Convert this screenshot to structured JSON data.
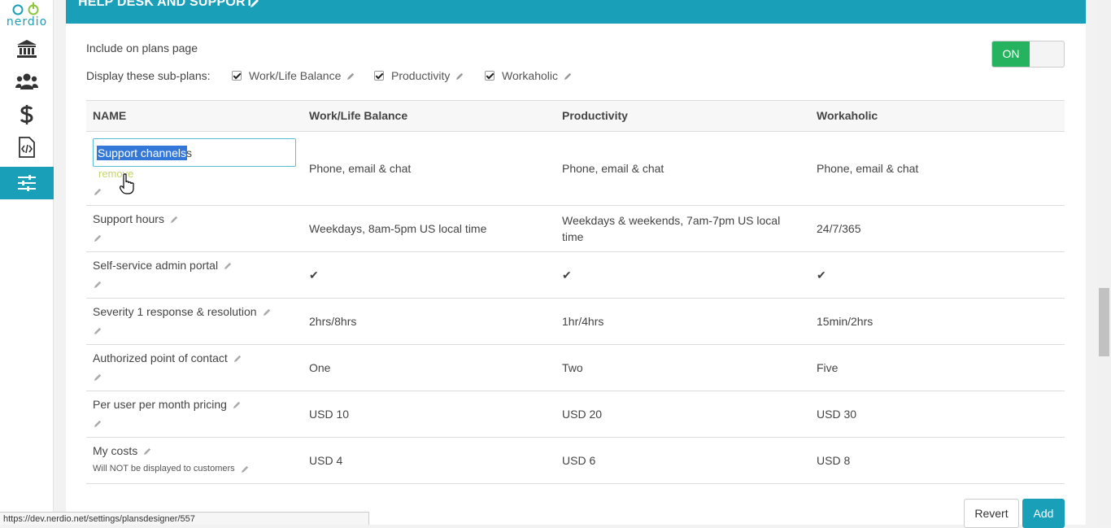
{
  "sidebar": {
    "logo_text": "nerdio",
    "items": [
      {
        "icon": "bank-icon",
        "active": false
      },
      {
        "icon": "users-icon",
        "active": false
      },
      {
        "icon": "dollar-icon",
        "active": false
      },
      {
        "icon": "code-file-icon",
        "active": false
      },
      {
        "icon": "sliders-icon",
        "active": true
      }
    ]
  },
  "card": {
    "title": "HELP DESK AND SUPPORT",
    "include_label": "Include on plans page",
    "toggle_label": "ON",
    "display_label": "Display these sub-plans:",
    "subplans": [
      "Work/Life Balance",
      "Productivity",
      "Workaholic"
    ]
  },
  "table": {
    "headers": [
      "NAME",
      "Work/Life Balance",
      "Productivity",
      "Workaholic"
    ],
    "editing_row": {
      "name_value": "Support channels",
      "remove_label": "remove",
      "values": [
        "Phone, email & chat",
        "Phone, email & chat",
        "Phone, email & chat"
      ]
    },
    "rows": [
      {
        "name": "Support hours",
        "values": [
          "Weekdays, 8am-5pm US local time",
          "Weekdays & weekends, 7am-7pm US local time",
          "24/7/365"
        ]
      },
      {
        "name": "Self-service admin portal",
        "values": [
          "✔",
          "✔",
          "✔"
        ]
      },
      {
        "name": "Severity 1 response & resolution",
        "values": [
          "2hrs/8hrs",
          "1hr/4hrs",
          "15min/2hrs"
        ]
      },
      {
        "name": "Authorized point of contact",
        "values": [
          "One",
          "Two",
          "Five"
        ]
      },
      {
        "name": "Per user per month pricing",
        "values": [
          "USD 10",
          "USD 20",
          "USD 30"
        ]
      },
      {
        "name": "My costs",
        "note": "Will NOT be displayed to customers",
        "values": [
          "USD 4",
          "USD 6",
          "USD 8"
        ]
      }
    ]
  },
  "actions": {
    "revert_label": "Revert",
    "add_label": "Add"
  },
  "status_bar": {
    "url": "https://dev.nerdio.net/settings/plansdesigner/557"
  },
  "colors": {
    "accent": "#1a9fb8",
    "toggle_on": "#26b35f",
    "remove_link": "#c3d56d",
    "selection": "#3378d8"
  }
}
